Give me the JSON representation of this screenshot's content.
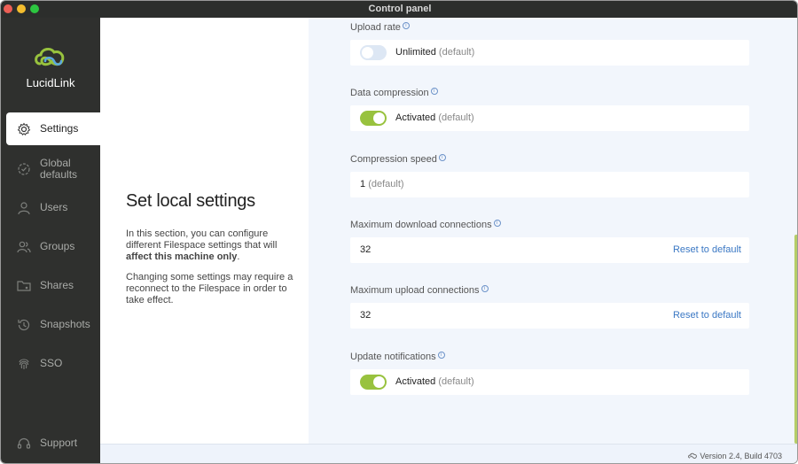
{
  "window": {
    "title": "Control panel"
  },
  "brand": {
    "name": "LucidLink",
    "accent": "#98c23e"
  },
  "sidebar": {
    "items": [
      {
        "label": "Settings",
        "icon": "gear-icon",
        "active": true
      },
      {
        "label": "Global defaults",
        "icon": "gear-badge-icon",
        "active": false
      },
      {
        "label": "Users",
        "icon": "user-icon",
        "active": false
      },
      {
        "label": "Groups",
        "icon": "users-icon",
        "active": false
      },
      {
        "label": "Shares",
        "icon": "folder-share-icon",
        "active": false
      },
      {
        "label": "Snapshots",
        "icon": "history-icon",
        "active": false
      },
      {
        "label": "SSO",
        "icon": "fingerprint-icon",
        "active": false
      }
    ],
    "support": {
      "label": "Support",
      "icon": "headset-icon"
    }
  },
  "intro": {
    "title": "Set local settings",
    "para1_prefix": "In this section, you can configure different Filespace settings that will ",
    "para1_bold": "affect this machine only",
    "para1_suffix": ".",
    "para2": "Changing some settings may require a reconnect to the Filespace in order to take effect."
  },
  "settings": {
    "upload_rate": {
      "label": "Upload rate",
      "value": "Unlimited",
      "note": "(default)",
      "toggle_on": false
    },
    "data_compression": {
      "label": "Data compression",
      "value": "Activated",
      "note": "(default)",
      "toggle_on": true
    },
    "compression_speed": {
      "label": "Compression speed",
      "value": "1",
      "note": "(default)"
    },
    "max_download": {
      "label": "Maximum download connections",
      "value": "32",
      "action": "Reset to default"
    },
    "max_upload": {
      "label": "Maximum upload connections",
      "value": "32",
      "action": "Reset to default"
    },
    "update_notifications": {
      "label": "Update notifications",
      "value": "Activated",
      "note": "(default)",
      "toggle_on": true
    }
  },
  "info_glyph": "i",
  "footer": {
    "version": "Version 2.4, Build 4703"
  }
}
